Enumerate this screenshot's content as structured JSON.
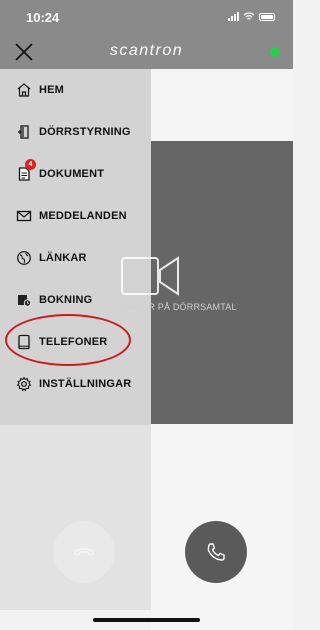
{
  "status_bar": {
    "time": "10:24"
  },
  "header": {
    "brand": "scantron"
  },
  "menu": {
    "items": [
      {
        "label": "HEM"
      },
      {
        "label": "DÖRRSTYRNING"
      },
      {
        "label": "DOKUMENT",
        "badge": "4"
      },
      {
        "label": "MEDDELANDEN"
      },
      {
        "label": "LÄNKAR"
      },
      {
        "label": "BOKNING"
      },
      {
        "label": "TELEFONER"
      },
      {
        "label": "INSTÄLLNINGAR"
      }
    ]
  },
  "call": {
    "waiting_text": "VÄNTAR PÅ DÖRRSAMTAL"
  },
  "colors": {
    "accent_green": "#24d24a",
    "badge_red": "#e02020",
    "highlight_red": "#d11a1a"
  }
}
